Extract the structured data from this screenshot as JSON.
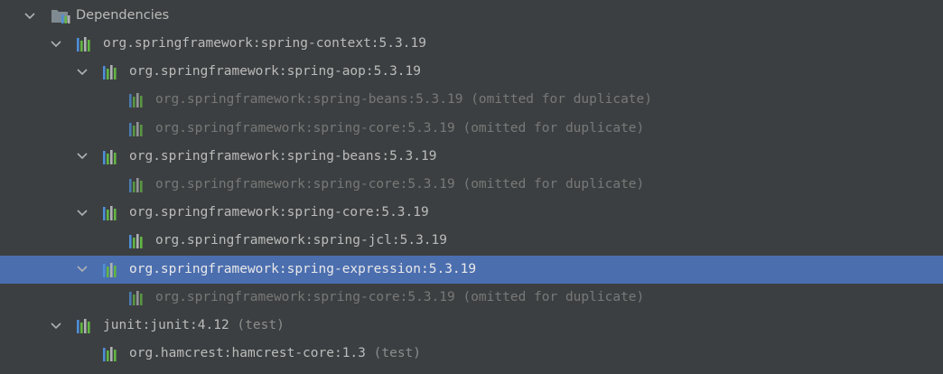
{
  "root": {
    "label": "Dependencies",
    "icon": "folder-library-icon"
  },
  "nodes": [
    {
      "id": "spring-context",
      "level": 1,
      "label": "org.springframework:spring-context:5.3.19",
      "note": "",
      "expanded": true,
      "dim": false,
      "selected": false
    },
    {
      "id": "spring-aop",
      "level": 2,
      "label": "org.springframework:spring-aop:5.3.19",
      "note": "",
      "expanded": true,
      "dim": false,
      "selected": false
    },
    {
      "id": "spring-aop-beans",
      "level": 3,
      "label": "org.springframework:spring-beans:5.3.19",
      "note": "(omitted for duplicate)",
      "expanded": false,
      "dim": true,
      "selected": false
    },
    {
      "id": "spring-aop-core",
      "level": 3,
      "label": "org.springframework:spring-core:5.3.19",
      "note": "(omitted for duplicate)",
      "expanded": false,
      "dim": true,
      "selected": false
    },
    {
      "id": "spring-beans",
      "level": 2,
      "label": "org.springframework:spring-beans:5.3.19",
      "note": "",
      "expanded": true,
      "dim": false,
      "selected": false
    },
    {
      "id": "spring-beans-core",
      "level": 3,
      "label": "org.springframework:spring-core:5.3.19",
      "note": "(omitted for duplicate)",
      "expanded": false,
      "dim": true,
      "selected": false
    },
    {
      "id": "spring-core",
      "level": 2,
      "label": "org.springframework:spring-core:5.3.19",
      "note": "",
      "expanded": true,
      "dim": false,
      "selected": false
    },
    {
      "id": "spring-jcl",
      "level": 3,
      "label": "org.springframework:spring-jcl:5.3.19",
      "note": "",
      "expanded": false,
      "dim": false,
      "selected": false
    },
    {
      "id": "spring-expression",
      "level": 2,
      "label": "org.springframework:spring-expression:5.3.19",
      "note": "",
      "expanded": true,
      "dim": false,
      "selected": true
    },
    {
      "id": "spring-expression-core",
      "level": 3,
      "label": "org.springframework:spring-core:5.3.19",
      "note": "(omitted for duplicate)",
      "expanded": false,
      "dim": true,
      "selected": false
    },
    {
      "id": "junit",
      "level": 1,
      "label": "junit:junit:4.12",
      "note": "(test)",
      "expanded": true,
      "dim": false,
      "selected": false
    },
    {
      "id": "hamcrest",
      "level": 2,
      "label": "org.hamcrest:hamcrest-core:1.3",
      "note": "(test)",
      "expanded": false,
      "dim": false,
      "selected": false
    }
  ],
  "colors": {
    "background": "#3c3f41",
    "selection": "#4b6eaf",
    "text": "#bbbbbb",
    "dim_text": "#787878",
    "note_text": "#8c8c8c",
    "arrow": "#afb1b3",
    "library_bars": [
      "#4e8fd6",
      "#62b543",
      "#afb1b3",
      "#62b543"
    ]
  },
  "icons": {
    "expanded_arrow": "chevron-down-icon",
    "library": "maven-library-icon"
  }
}
